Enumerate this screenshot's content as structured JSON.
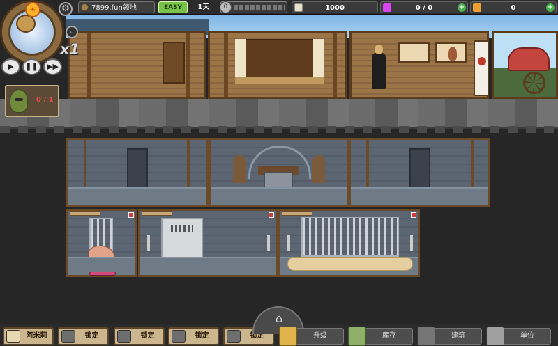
{
  "topbar": {
    "territory": "7899.fun领地",
    "difficulty": "EASY",
    "day": "1天",
    "progress_counter": "0",
    "gold": "1000",
    "gems": "0 / 0",
    "captives": "0"
  },
  "hud": {
    "speed": "x1",
    "sun_icon": "sun-icon",
    "gear_icon": "gear-icon",
    "zoom_icon": "magnifier-icon",
    "play_icon": "play-icon",
    "pause_icon": "pause-icon",
    "fast_forward_icon": "fast-forward-icon",
    "unit_count": "0 / 1"
  },
  "bottombar": {
    "hero_name": "阿米莉娅",
    "locked_slots": [
      "锁定",
      "锁定",
      "锁定",
      "锁定"
    ],
    "home_icon": "home-icon",
    "menu": [
      {
        "label": "升级",
        "icon": "upgrade-icon"
      },
      {
        "label": "库存",
        "icon": "storage-icon"
      },
      {
        "label": "建筑",
        "icon": "build-icon"
      },
      {
        "label": "单位",
        "icon": "unit-icon"
      }
    ]
  },
  "colors": {
    "difficulty_bg": "#79c24a",
    "gem": "#d946ef",
    "plus": "#4caf50",
    "wood": "#9b7547",
    "stone": "#5c6673"
  }
}
